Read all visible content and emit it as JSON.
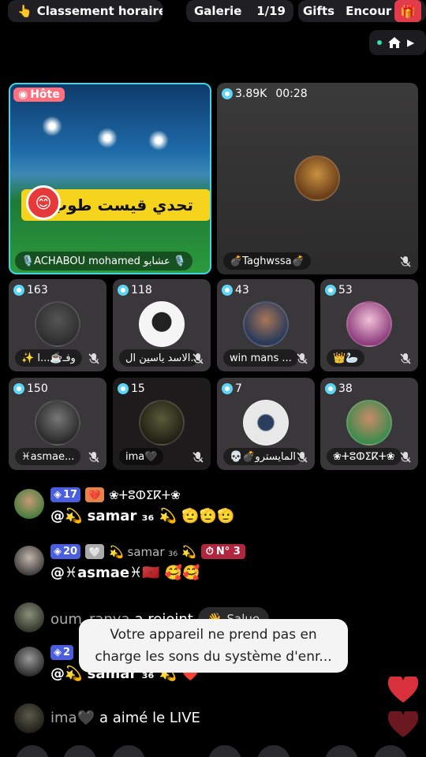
{
  "top": {
    "ranking_label": "Classement horaire",
    "gallery_label": "Galerie",
    "gallery_page": "1/19",
    "gifts_label": "Gifts",
    "encourage_label": "Encour"
  },
  "host_tile": {
    "tag": "Hôte",
    "banner": "تحدي قيست طوب1",
    "name": "🎙️ACHABOU mohamed عشابو 🎙️"
  },
  "second_tile": {
    "viewers": "3.89K",
    "timer": "00:28",
    "name": "💣Taghwssa💣"
  },
  "guests": [
    {
      "count": "163",
      "name": "✨ وفـ☕️...ا"
    },
    {
      "count": "118",
      "name": "الاسد ياسين ال..."
    },
    {
      "count": "43",
      "name": "win mans ..."
    },
    {
      "count": "53",
      "name": "👑🦢"
    },
    {
      "count": "150",
      "name": "♓asmae..."
    },
    {
      "count": "15",
      "name": "ima🖤"
    },
    {
      "count": "7",
      "name": "💀💣المايسترو"
    },
    {
      "count": "38",
      "name": "❀ⵜⵓⵀⵉⴽⵜ❀"
    }
  ],
  "chat": [
    {
      "level": "17",
      "badge_text": "❀ⵜⵓⵀⵉⴽⵜ❀",
      "message": "@💫 samar ₃₆ 💫 🫡🫡🫡"
    },
    {
      "level": "20",
      "badge_text": "💫 samar ₃₆ 💫",
      "rank": "N° 3",
      "message": "@♓asmae♓🇲🇦 🥰🥰"
    },
    {
      "name": "oum_ranya",
      "action": "a rejoint",
      "salue": "Salue"
    },
    {
      "level": "2",
      "message": "@💫 samar ₃₆ 💫 ❤️"
    },
    {
      "name": "ima🖤",
      "action": "a aimé le LIVE"
    }
  ],
  "toast": {
    "line1": "Votre appareil ne prend pas en",
    "line2": "charge les sons du système d'enr..."
  },
  "colors": {
    "accent_teal": "#3fd4e6",
    "host_tag": "#ff6f7d",
    "level_badge": "#4a5fe0",
    "heart": "#d9313c"
  }
}
